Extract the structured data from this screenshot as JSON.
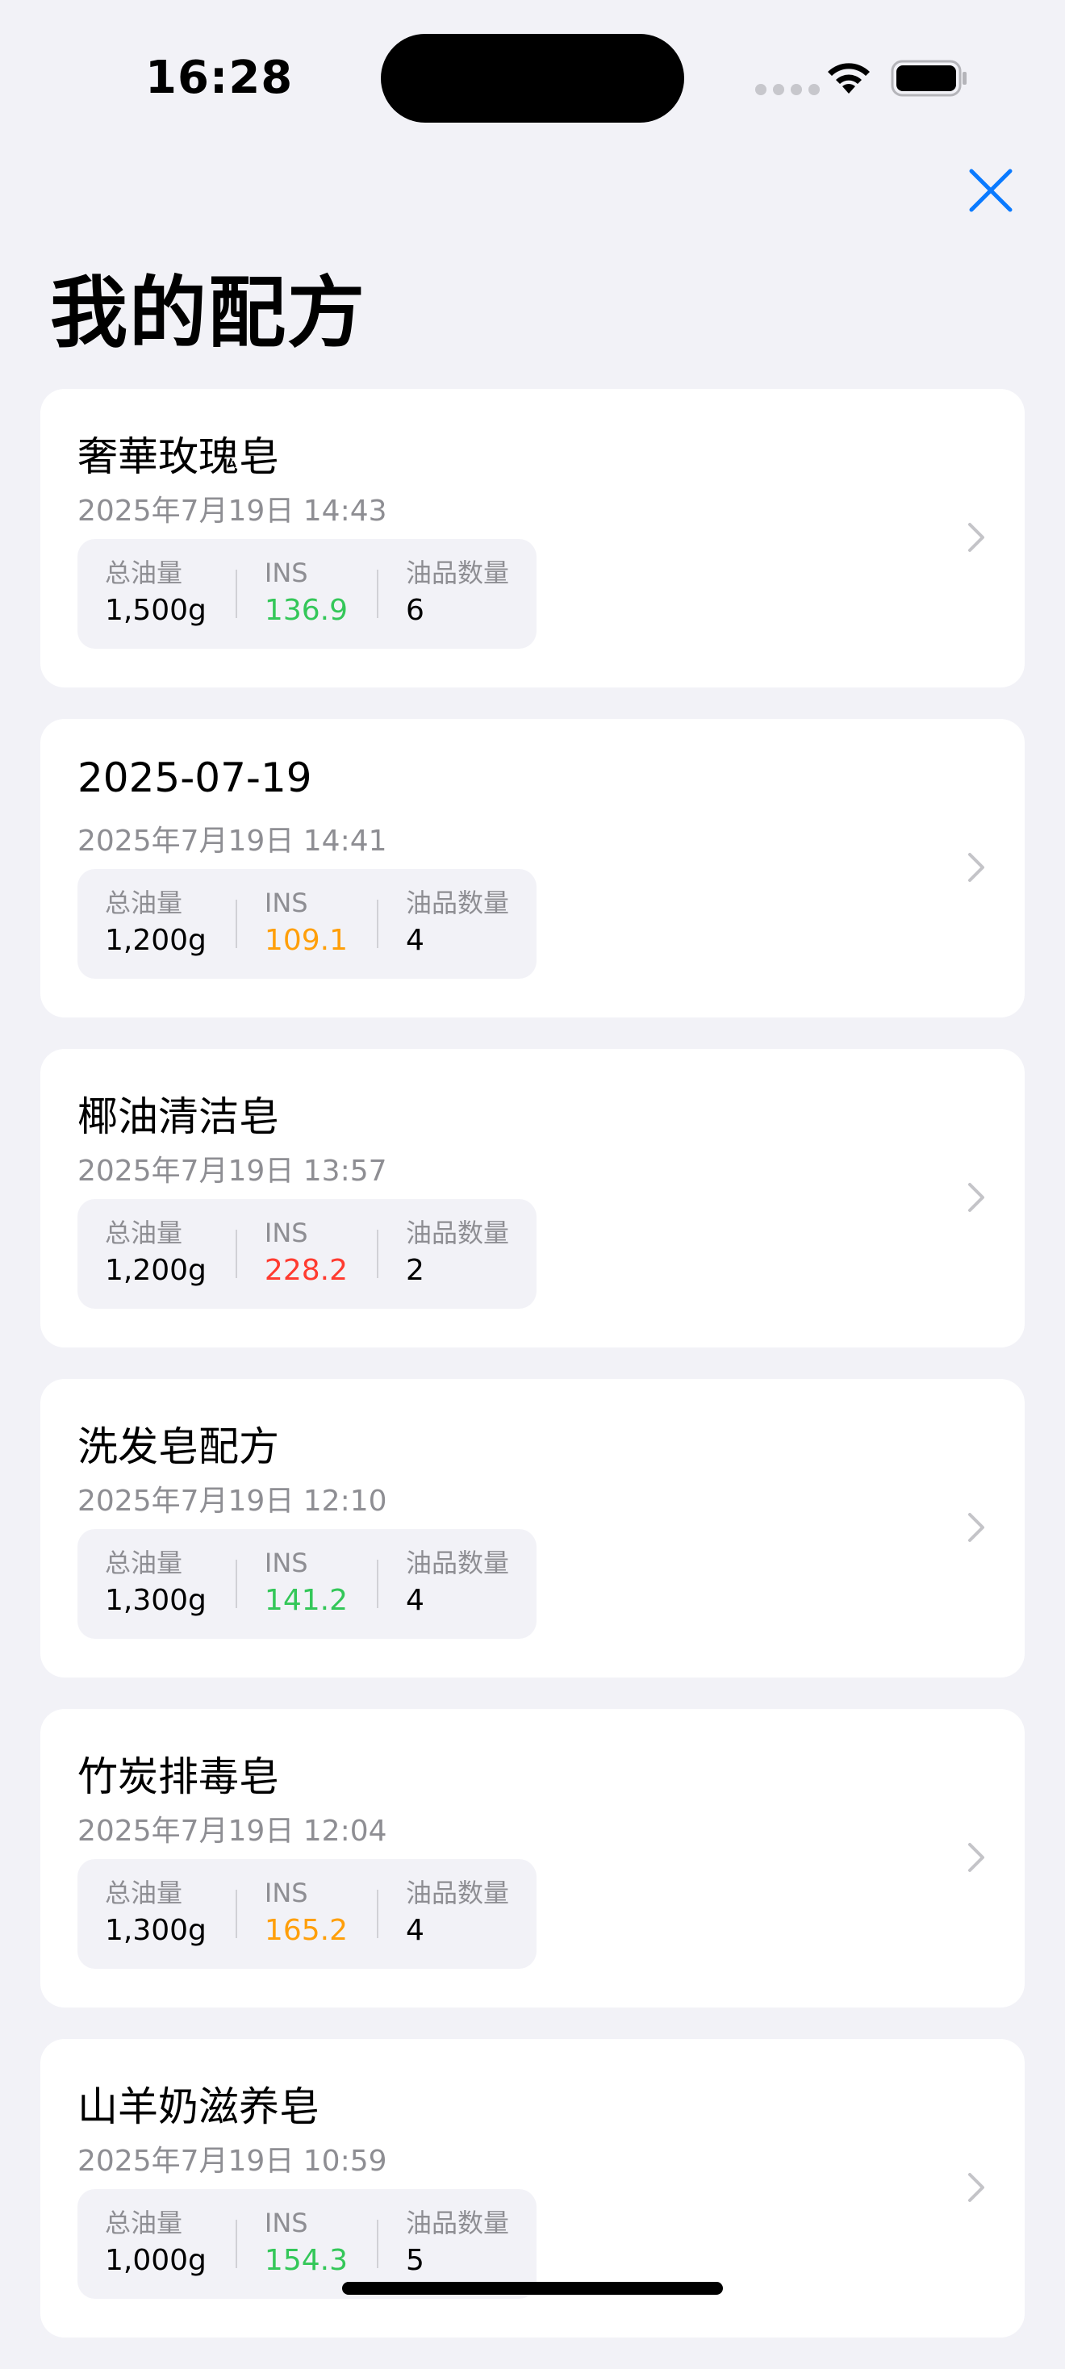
{
  "status": {
    "time": "16:28"
  },
  "colors": {
    "accent": "#0a7aff",
    "ins_good": "#34c759",
    "ins_warn": "#ff9f0a",
    "ins_bad": "#ff3b30"
  },
  "title": "我的配方",
  "labels": {
    "total_oil": "总油量",
    "ins": "INS",
    "oil_count": "油品数量"
  },
  "recipes": [
    {
      "name": "奢華玫瑰皂",
      "date": "2025年7月19日 14:43",
      "total_oil": "1,500g",
      "ins": "136.9",
      "ins_status": "good",
      "oil_count": "6"
    },
    {
      "name": "2025-07-19",
      "date": "2025年7月19日 14:41",
      "total_oil": "1,200g",
      "ins": "109.1",
      "ins_status": "warn",
      "oil_count": "4"
    },
    {
      "name": "椰油清洁皂",
      "date": "2025年7月19日 13:57",
      "total_oil": "1,200g",
      "ins": "228.2",
      "ins_status": "bad",
      "oil_count": "2"
    },
    {
      "name": "洗发皂配方",
      "date": "2025年7月19日 12:10",
      "total_oil": "1,300g",
      "ins": "141.2",
      "ins_status": "good",
      "oil_count": "4"
    },
    {
      "name": "竹炭排毒皂",
      "date": "2025年7月19日 12:04",
      "total_oil": "1,300g",
      "ins": "165.2",
      "ins_status": "warn",
      "oil_count": "4"
    },
    {
      "name": "山羊奶滋养皂",
      "date": "2025年7月19日 10:59",
      "total_oil": "1,000g",
      "ins": "154.3",
      "ins_status": "good",
      "oil_count": "5"
    }
  ]
}
